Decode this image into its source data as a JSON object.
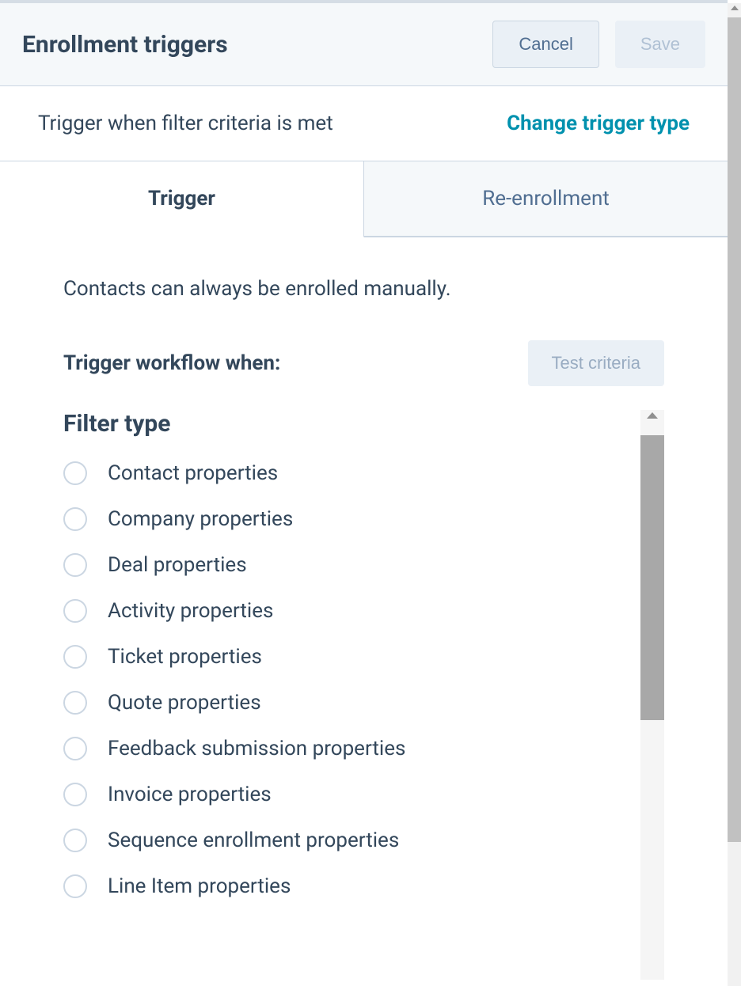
{
  "header": {
    "title": "Enrollment triggers",
    "cancel_label": "Cancel",
    "save_label": "Save"
  },
  "subheader": {
    "text": "Trigger when filter criteria is met",
    "change_link": "Change trigger type"
  },
  "tabs": {
    "trigger": "Trigger",
    "reenrollment": "Re-enrollment"
  },
  "content": {
    "intro": "Contacts can always be enrolled manually.",
    "trigger_label": "Trigger workflow when:",
    "test_label": "Test criteria",
    "filter_title": "Filter type",
    "filters": [
      "Contact properties",
      "Company properties",
      "Deal properties",
      "Activity properties",
      "Ticket properties",
      "Quote properties",
      "Feedback submission properties",
      "Invoice properties",
      "Sequence enrollment properties",
      "Line Item properties"
    ]
  }
}
